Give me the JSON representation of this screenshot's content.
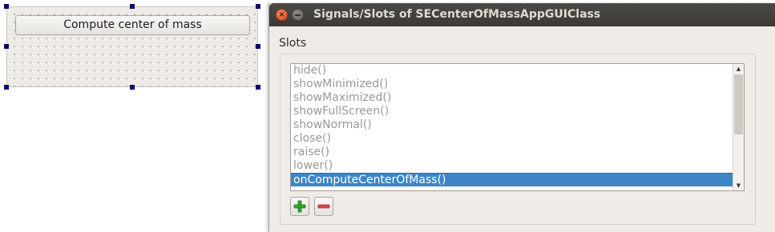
{
  "form_preview": {
    "button_label": "Compute center of mass"
  },
  "dialog": {
    "title": "Signals/Slots of SECenterOfMassAppGUIClass",
    "close_glyph": "×",
    "section_label": "Slots",
    "slots": [
      {
        "label": "hide()",
        "selected": false
      },
      {
        "label": "showMinimized()",
        "selected": false
      },
      {
        "label": "showMaximized()",
        "selected": false
      },
      {
        "label": "showFullScreen()",
        "selected": false
      },
      {
        "label": "showNormal()",
        "selected": false
      },
      {
        "label": "close()",
        "selected": false
      },
      {
        "label": "raise()",
        "selected": false
      },
      {
        "label": "lower()",
        "selected": false
      },
      {
        "label": "onComputeCenterOfMass()",
        "selected": true
      }
    ],
    "scroll_up_glyph": "▲",
    "scroll_down_glyph": "▼",
    "add_icon": "plus-icon",
    "remove_icon": "minus-icon"
  },
  "colors": {
    "selection": "#3d86c6",
    "titlebar": "#3f3e3a",
    "close_button": "#e5531c",
    "add_green": "#2fa82f",
    "remove_red": "#d8474a"
  }
}
